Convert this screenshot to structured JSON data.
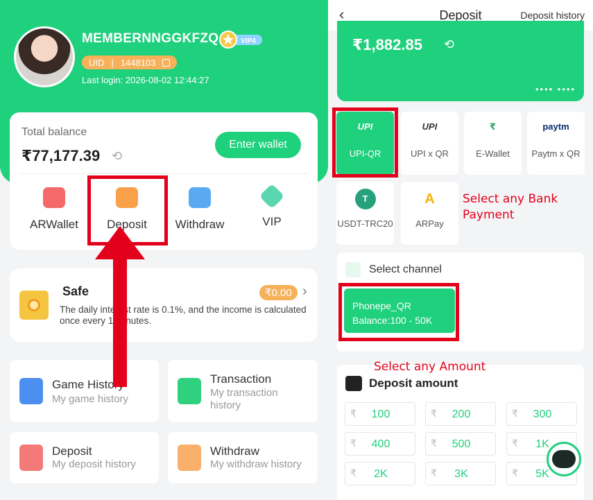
{
  "left": {
    "user": {
      "username": "MEMBERNNGGKFZQ",
      "vip_badge": "VIP4",
      "uid_label": "UID",
      "uid_value": "1448103",
      "last_login": "Last login: 2026-08-02 12:44:27"
    },
    "balance": {
      "label": "Total balance",
      "value": "₹77,177.39",
      "enter_wallet": "Enter wallet"
    },
    "actions": [
      {
        "label": "ARWallet"
      },
      {
        "label": "Deposit"
      },
      {
        "label": "Withdraw"
      },
      {
        "label": "VIP"
      }
    ],
    "safe": {
      "title": "Safe",
      "amount": "₹0.00",
      "description": "The daily interest rate is 0.1%, and the income is calculated once every 1 minutes."
    },
    "tiles": [
      {
        "title": "Game History",
        "subtitle": "My game history"
      },
      {
        "title": "Transaction",
        "subtitle": "My transaction history"
      },
      {
        "title": "Deposit",
        "subtitle": "My deposit history"
      },
      {
        "title": "Withdraw",
        "subtitle": "My withdraw history"
      }
    ]
  },
  "right": {
    "header": {
      "title": "Deposit",
      "history": "Deposit history"
    },
    "balance": "₹1,882.85",
    "balance_dots": "•••• ••••",
    "methods": [
      {
        "logo": "UPI",
        "name": "UPI-QR"
      },
      {
        "logo": "UPI",
        "name": "UPI x QR"
      },
      {
        "logo": "₹",
        "name": "E-Wallet"
      },
      {
        "logo": "paytm",
        "name": "Paytm x QR"
      },
      {
        "logo": "T",
        "name": "USDT-TRC20"
      },
      {
        "logo": "A",
        "name": "ARPay"
      }
    ],
    "annotation_bank": "Select any Bank Payment",
    "channel": {
      "heading": "Select channel",
      "name": "Phonepe_QR",
      "balance": "Balance:100 - 50K"
    },
    "annotation_amount": "Select any Amount",
    "amount": {
      "heading": "Deposit amount",
      "currency": "₹",
      "options": [
        "100",
        "200",
        "300",
        "400",
        "500",
        "1K",
        "2K",
        "3K",
        "5K"
      ]
    }
  },
  "colors": {
    "brand_green": "#1fd07c",
    "highlight_red": "#e3001b",
    "badge_orange": "#f6b15a"
  }
}
